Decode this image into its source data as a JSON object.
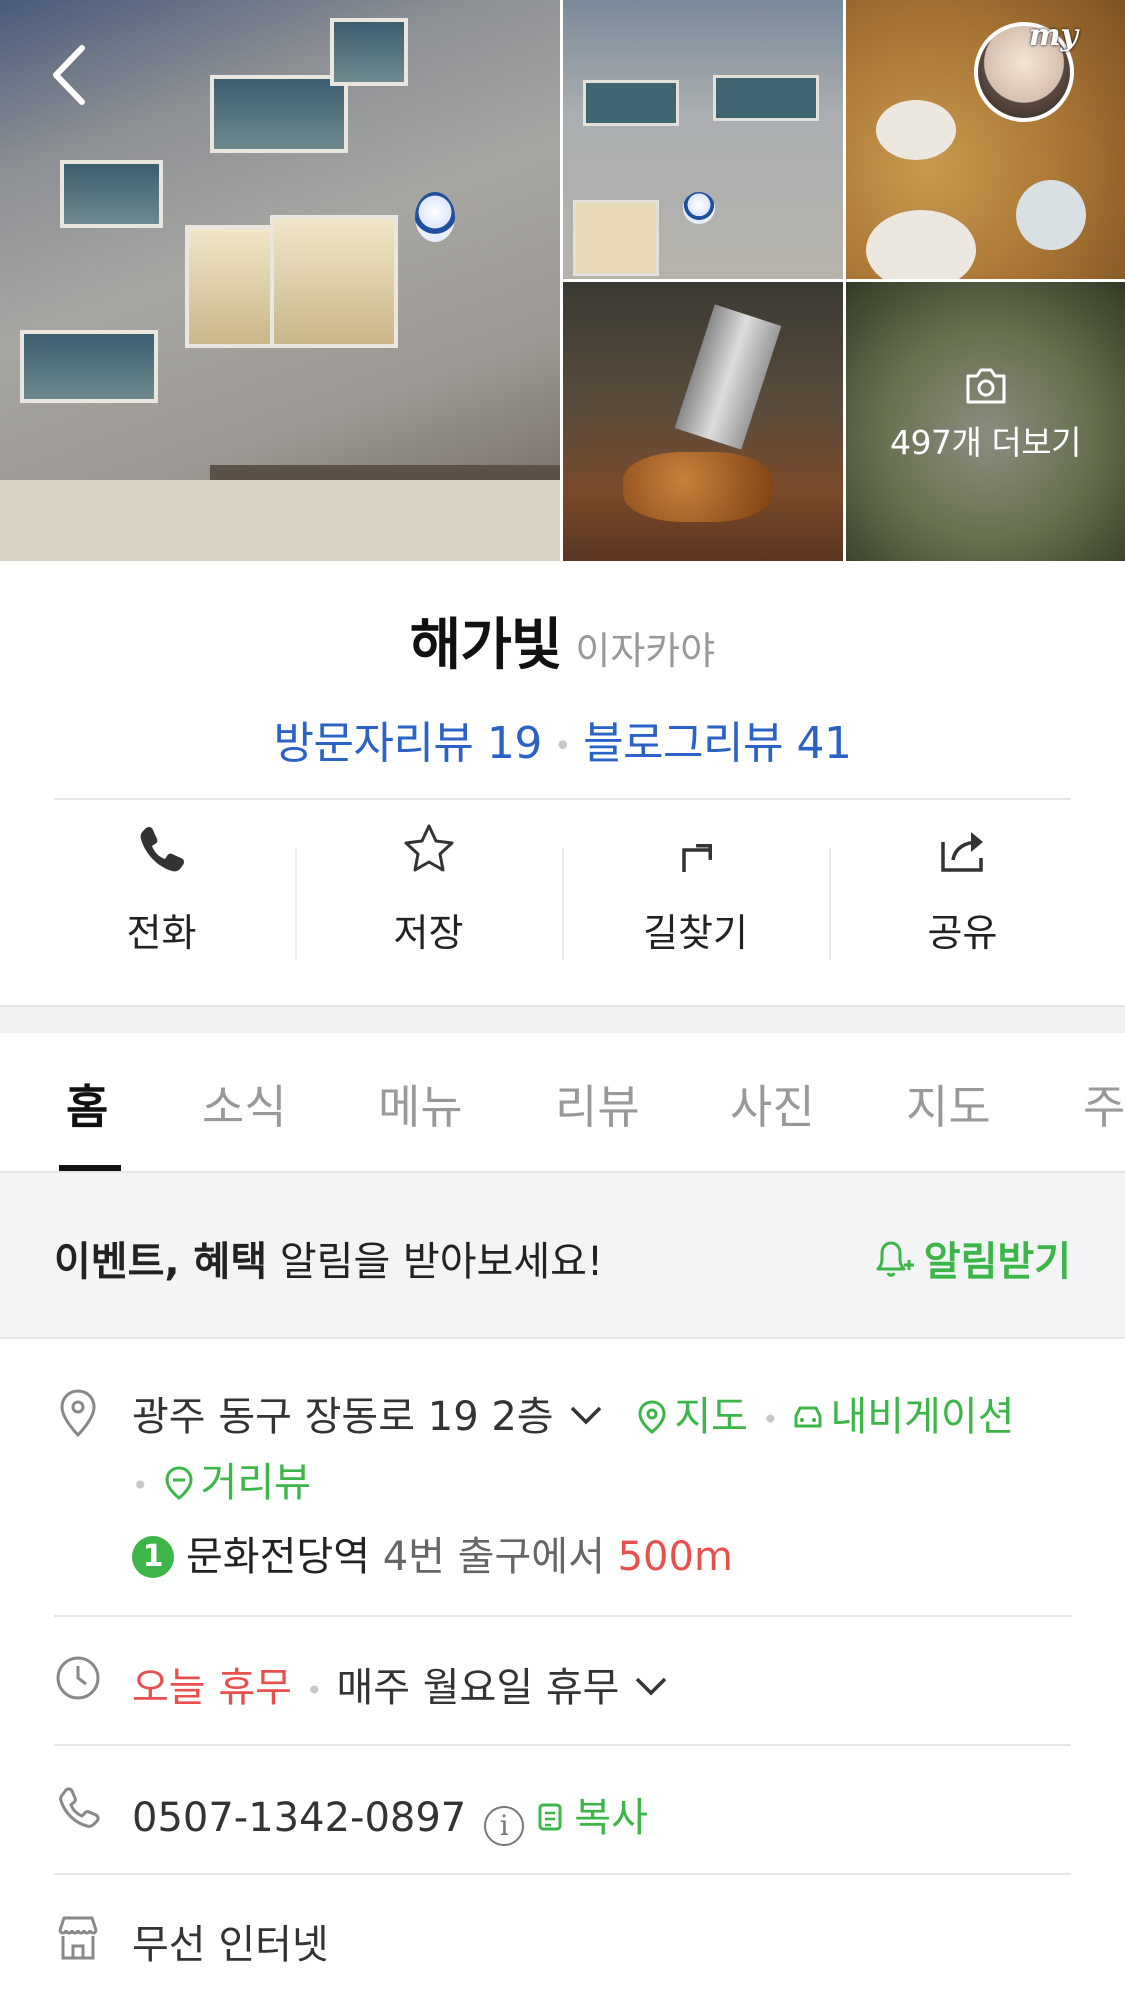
{
  "photos": {
    "more_label": "497개 더보기"
  },
  "header": {
    "my_badge": "my"
  },
  "place": {
    "name": "해가빛",
    "category": "이자카야",
    "visitor_reviews": "방문자리뷰 19",
    "blog_reviews": "블로그리뷰 41"
  },
  "actions": [
    {
      "label": "전화",
      "icon": "phone-icon"
    },
    {
      "label": "저장",
      "icon": "star-icon"
    },
    {
      "label": "길찾기",
      "icon": "directions-icon"
    },
    {
      "label": "공유",
      "icon": "share-icon"
    }
  ],
  "tabs": [
    "홈",
    "소식",
    "메뉴",
    "리뷰",
    "사진",
    "지도",
    "주"
  ],
  "active_tab": "홈",
  "notice": {
    "bold": "이벤트, 혜택",
    "text": " 알림을 받아보세요!",
    "subscribe_label": "알림받기"
  },
  "address": {
    "text": "광주 동구 장동로 19 2층",
    "map_label": "지도",
    "navigation_label": "내비게이션",
    "street_view_label": "거리뷰",
    "subway_line": "1",
    "station": "문화전당역",
    "exit": "4번 출구에서",
    "distance": "500m"
  },
  "hours": {
    "today_status": "오늘 휴무",
    "schedule": "매주 월요일 휴무"
  },
  "phone": {
    "number": "0507-1342-0897",
    "info_symbol": "i",
    "copy_label": "복사"
  },
  "amenities": {
    "text": "무선 인터넷"
  },
  "colors": {
    "link_blue": "#2a62c6",
    "accent_green": "#3cb648",
    "alert_red": "#ea4f4f",
    "muted_gray": "#999999"
  }
}
